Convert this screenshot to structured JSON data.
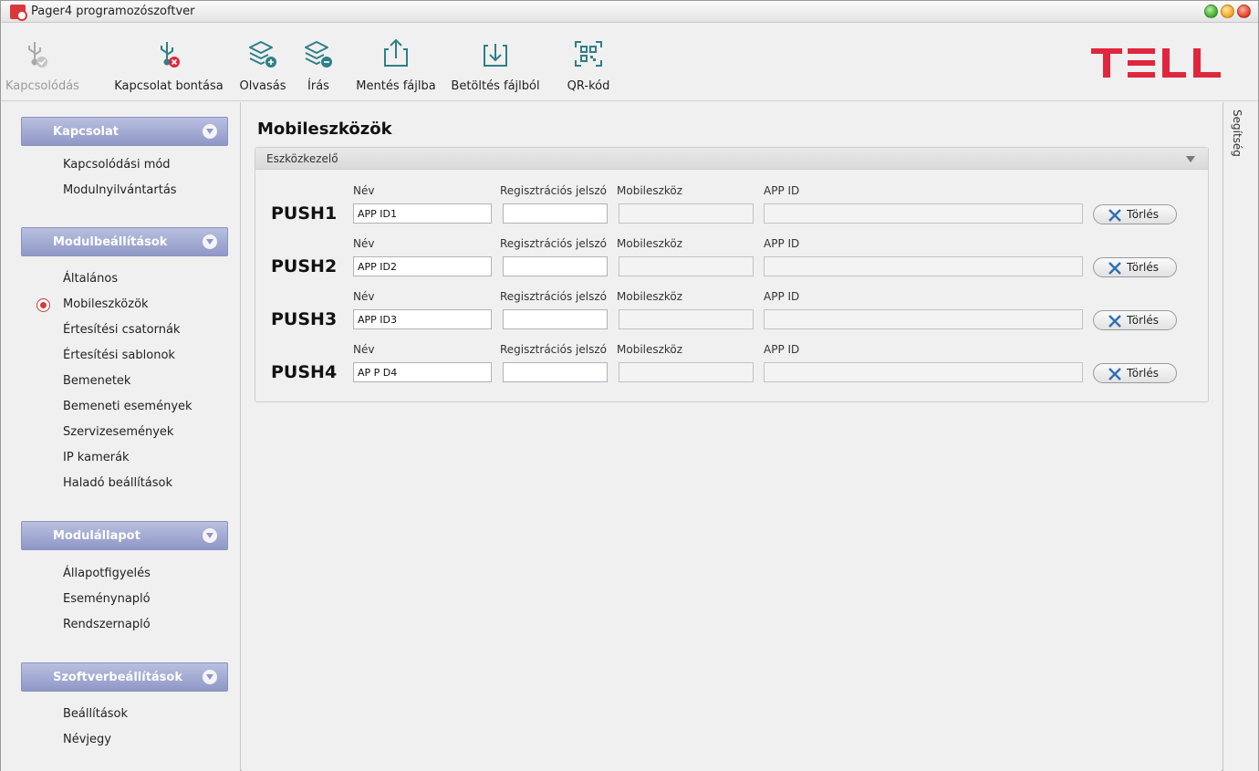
{
  "window": {
    "title": "Pager4 programozószoftver"
  },
  "toolbar": {
    "connect_label": "Kapcsolódás",
    "disconnect_label": "Kapcsolat bontása",
    "read_label": "Olvasás",
    "write_label": "Írás",
    "save_file_label": "Mentés fájlba",
    "load_file_label": "Betöltés fájlból",
    "qr_label": "QR-kód",
    "logo_text": "TELL"
  },
  "sidebar": {
    "sections": [
      {
        "title": "Kapcsolat",
        "items": [
          "Kapcsolódási mód",
          "Modulnyilvántartás"
        ]
      },
      {
        "title": "Modulbeállítások",
        "items": [
          "Általános",
          "Mobileszközök",
          "Értesítési csatornák",
          "Értesítési sablonok",
          "Bemenetek",
          "Bemeneti események",
          "Szervizesemények",
          "IP kamerák",
          "Haladó beállítások"
        ]
      },
      {
        "title": "Modulállapot",
        "items": [
          "Állapotfigyelés",
          "Eseménynapló",
          "Rendszernapló"
        ]
      },
      {
        "title": "Szoftverbeállítások",
        "items": [
          "Beállítások",
          "Névjegy"
        ]
      }
    ],
    "selected_item": "Mobileszközök"
  },
  "main": {
    "title": "Mobileszközök",
    "panel_title": "Eszközkezelő",
    "labels": {
      "name": "Név",
      "reg_password": "Regisztrációs jelszó",
      "mobile_device": "Mobileszköz",
      "app_id": "APP ID",
      "delete": "Törlés"
    },
    "rows": [
      {
        "push": "PUSH1",
        "name": "APP ID1",
        "reg_password": "",
        "mobile_device": "",
        "app_id": ""
      },
      {
        "push": "PUSH2",
        "name": "APP ID2",
        "reg_password": "",
        "mobile_device": "",
        "app_id": ""
      },
      {
        "push": "PUSH3",
        "name": "APP ID3",
        "reg_password": "",
        "mobile_device": "",
        "app_id": ""
      },
      {
        "push": "PUSH4",
        "name": "AP P D4",
        "reg_password": "",
        "mobile_device": "",
        "app_id": ""
      }
    ]
  },
  "help": {
    "label": "Segítség"
  },
  "colors": {
    "section_header": "#8f97c6",
    "logo_red": "#e0263c",
    "radio_red": "#d23a3a"
  }
}
